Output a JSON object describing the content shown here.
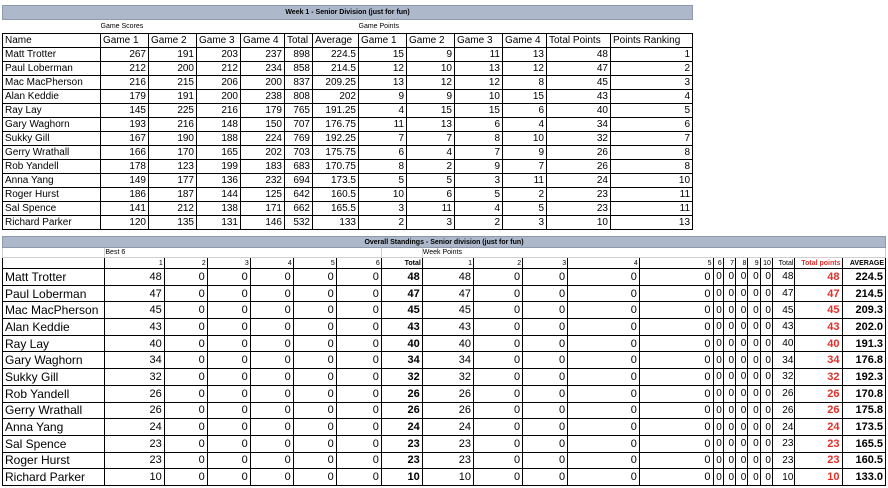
{
  "week": {
    "title": "Week 1 - Senior Division (just for fun)",
    "group_game_scores": "Game Scores",
    "group_game_points": "Game Points",
    "headers": [
      "Name",
      "Game 1",
      "Game 2",
      "Game 3",
      "Game 4",
      "Total",
      "Average",
      "Game 1",
      "Game 2",
      "Game 3",
      "Game 4",
      "Total Points",
      "Points Ranking"
    ],
    "rows": [
      [
        "Matt Trotter",
        "267",
        "191",
        "203",
        "237",
        "898",
        "224.5",
        "15",
        "9",
        "11",
        "13",
        "48",
        "1"
      ],
      [
        "Paul Loberman",
        "212",
        "200",
        "212",
        "234",
        "858",
        "214.5",
        "12",
        "10",
        "13",
        "12",
        "47",
        "2"
      ],
      [
        "Mac MacPherson",
        "216",
        "215",
        "206",
        "200",
        "837",
        "209.25",
        "13",
        "12",
        "12",
        "8",
        "45",
        "3"
      ],
      [
        "Alan Keddie",
        "179",
        "191",
        "200",
        "238",
        "808",
        "202",
        "9",
        "9",
        "10",
        "15",
        "43",
        "4"
      ],
      [
        "Ray Lay",
        "145",
        "225",
        "216",
        "179",
        "765",
        "191.25",
        "4",
        "15",
        "15",
        "6",
        "40",
        "5"
      ],
      [
        "Gary Waghorn",
        "193",
        "216",
        "148",
        "150",
        "707",
        "176.75",
        "11",
        "13",
        "6",
        "4",
        "34",
        "6"
      ],
      [
        "Sukky Gill",
        "167",
        "190",
        "188",
        "224",
        "769",
        "192.25",
        "7",
        "7",
        "8",
        "10",
        "32",
        "7"
      ],
      [
        "Gerry Wrathall",
        "166",
        "170",
        "165",
        "202",
        "703",
        "175.75",
        "6",
        "4",
        "7",
        "9",
        "26",
        "8"
      ],
      [
        "Rob Yandell",
        "178",
        "123",
        "199",
        "183",
        "683",
        "170.75",
        "8",
        "2",
        "9",
        "7",
        "26",
        "8"
      ],
      [
        "Anna Yang",
        "149",
        "177",
        "136",
        "232",
        "694",
        "173.5",
        "5",
        "5",
        "3",
        "11",
        "24",
        "10"
      ],
      [
        "Roger Hurst",
        "186",
        "187",
        "144",
        "125",
        "642",
        "160.5",
        "10",
        "6",
        "5",
        "2",
        "23",
        "11"
      ],
      [
        "Sal Spence",
        "141",
        "212",
        "138",
        "171",
        "662",
        "165.5",
        "3",
        "11",
        "4",
        "5",
        "23",
        "11"
      ],
      [
        "Richard Parker",
        "120",
        "135",
        "131",
        "146",
        "532",
        "133",
        "2",
        "3",
        "2",
        "3",
        "10",
        "13"
      ]
    ]
  },
  "overall": {
    "title": "Overall Standings - Senior division (just for fun)",
    "group_best6": "Best 6",
    "group_week_points": "Week Points",
    "headers": [
      "",
      "1",
      "2",
      "3",
      "4",
      "5",
      "6",
      "Total",
      "1",
      "2",
      "3",
      "4",
      "5",
      "6",
      "7",
      "8",
      "9",
      "10",
      "Total",
      "Total points",
      "AVERAGE"
    ],
    "rows": [
      [
        "Matt Trotter",
        "48",
        "0",
        "0",
        "0",
        "0",
        "0",
        "48",
        "48",
        "0",
        "0",
        "0",
        "0",
        "0",
        "0",
        "0",
        "0",
        "0",
        "48",
        "48",
        "224.5"
      ],
      [
        "Paul Loberman",
        "47",
        "0",
        "0",
        "0",
        "0",
        "0",
        "47",
        "47",
        "0",
        "0",
        "0",
        "0",
        "0",
        "0",
        "0",
        "0",
        "0",
        "47",
        "47",
        "214.5"
      ],
      [
        "Mac MacPherson",
        "45",
        "0",
        "0",
        "0",
        "0",
        "0",
        "45",
        "45",
        "0",
        "0",
        "0",
        "0",
        "0",
        "0",
        "0",
        "0",
        "0",
        "45",
        "45",
        "209.3"
      ],
      [
        "Alan Keddie",
        "43",
        "0",
        "0",
        "0",
        "0",
        "0",
        "43",
        "43",
        "0",
        "0",
        "0",
        "0",
        "0",
        "0",
        "0",
        "0",
        "0",
        "43",
        "43",
        "202.0"
      ],
      [
        "Ray Lay",
        "40",
        "0",
        "0",
        "0",
        "0",
        "0",
        "40",
        "40",
        "0",
        "0",
        "0",
        "0",
        "0",
        "0",
        "0",
        "0",
        "0",
        "40",
        "40",
        "191.3"
      ],
      [
        "Gary Waghorn",
        "34",
        "0",
        "0",
        "0",
        "0",
        "0",
        "34",
        "34",
        "0",
        "0",
        "0",
        "0",
        "0",
        "0",
        "0",
        "0",
        "0",
        "34",
        "34",
        "176.8"
      ],
      [
        "Sukky Gill",
        "32",
        "0",
        "0",
        "0",
        "0",
        "0",
        "32",
        "32",
        "0",
        "0",
        "0",
        "0",
        "0",
        "0",
        "0",
        "0",
        "0",
        "32",
        "32",
        "192.3"
      ],
      [
        "Rob Yandell",
        "26",
        "0",
        "0",
        "0",
        "0",
        "0",
        "26",
        "26",
        "0",
        "0",
        "0",
        "0",
        "0",
        "0",
        "0",
        "0",
        "0",
        "26",
        "26",
        "170.8"
      ],
      [
        "Gerry Wrathall",
        "26",
        "0",
        "0",
        "0",
        "0",
        "0",
        "26",
        "26",
        "0",
        "0",
        "0",
        "0",
        "0",
        "0",
        "0",
        "0",
        "0",
        "26",
        "26",
        "175.8"
      ],
      [
        "Anna Yang",
        "24",
        "0",
        "0",
        "0",
        "0",
        "0",
        "24",
        "24",
        "0",
        "0",
        "0",
        "0",
        "0",
        "0",
        "0",
        "0",
        "0",
        "24",
        "24",
        "173.5"
      ],
      [
        "Sal Spence",
        "23",
        "0",
        "0",
        "0",
        "0",
        "0",
        "23",
        "23",
        "0",
        "0",
        "0",
        "0",
        "0",
        "0",
        "0",
        "0",
        "0",
        "23",
        "23",
        "165.5"
      ],
      [
        "Roger Hurst",
        "23",
        "0",
        "0",
        "0",
        "0",
        "0",
        "23",
        "23",
        "0",
        "0",
        "0",
        "0",
        "0",
        "0",
        "0",
        "0",
        "0",
        "23",
        "23",
        "160.5"
      ],
      [
        "Richard Parker",
        "10",
        "0",
        "0",
        "0",
        "0",
        "0",
        "10",
        "10",
        "0",
        "0",
        "0",
        "0",
        "0",
        "0",
        "0",
        "0",
        "0",
        "10",
        "10",
        "133.0"
      ]
    ]
  },
  "colors": {
    "header_band": "#adb9ca",
    "accent_red": "#e0302a"
  }
}
